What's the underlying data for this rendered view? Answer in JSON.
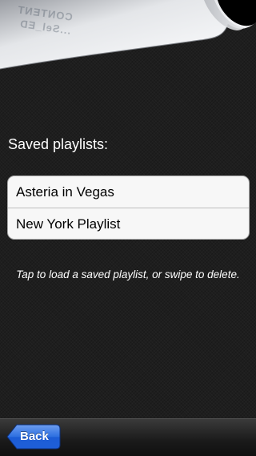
{
  "curl": {
    "text_lines": [
      "CONTENT",
      "...Sel_ED"
    ]
  },
  "saved_section": {
    "label": "Saved playlists:"
  },
  "playlists": [
    {
      "name": "Asteria in Vegas"
    },
    {
      "name": "New York Playlist"
    }
  ],
  "hint": "Tap to load a saved playlist, or swipe to delete.",
  "toolbar": {
    "back_label": "Back",
    "accent_color": "#1f5fd8"
  }
}
